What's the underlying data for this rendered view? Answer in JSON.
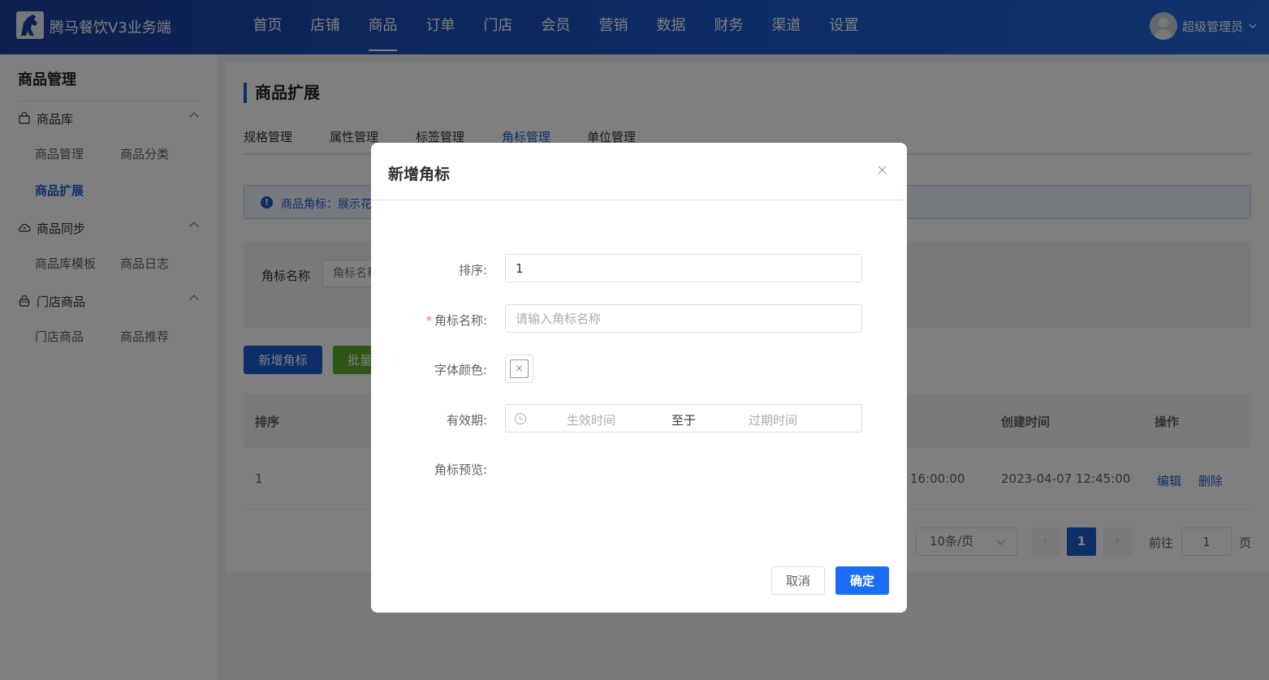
{
  "app": {
    "title": "腾马餐饮V3业务端"
  },
  "nav": {
    "items": [
      "首页",
      "店铺",
      "商品",
      "订单",
      "门店",
      "会员",
      "营销",
      "数据",
      "财务",
      "渠道",
      "设置"
    ],
    "active_index": 2
  },
  "user": {
    "name": "超级管理员"
  },
  "sidebar": {
    "title": "商品管理",
    "groups": [
      {
        "label": "商品库",
        "icon": "bag-icon",
        "items": [
          "商品管理",
          "商品分类",
          "商品扩展"
        ]
      },
      {
        "label": "商品同步",
        "icon": "cloud-sync-icon",
        "items": [
          "商品库模板",
          "商品日志"
        ]
      },
      {
        "label": "门店商品",
        "icon": "shop-bag-icon",
        "items": [
          "门店商品",
          "商品推荐"
        ]
      }
    ],
    "active_item": "商品扩展"
  },
  "page": {
    "title": "商品扩展",
    "tabs": [
      "规格管理",
      "属性管理",
      "标签管理",
      "角标管理",
      "单位管理"
    ],
    "active_tab": "角标管理",
    "tip": "商品角标：展示花"
  },
  "filter": {
    "label": "角标名称",
    "placeholder": "角标名称"
  },
  "actions": {
    "add_label": "新增角标",
    "batch_label": "批量"
  },
  "table": {
    "columns": [
      "排序",
      "创建时间",
      "操作"
    ],
    "rows": [
      {
        "sort": "1",
        "time_partial": "16:00:00",
        "created": "2023-04-07 12:45:00",
        "edit": "编辑",
        "delete": "删除"
      }
    ]
  },
  "pagination": {
    "page_size": "10条/页",
    "current": "1",
    "goto_label": "前往",
    "goto_value": "1",
    "page_unit": "页",
    "prev": "‹",
    "next": "›"
  },
  "dialog": {
    "title": "新增角标",
    "fields": {
      "sort_label": "排序:",
      "sort_value": "1",
      "name_required": "*",
      "name_label": "角标名称:",
      "name_placeholder": "请输入角标名称",
      "color_label": "字体颜色:",
      "color_empty_glyph": "×",
      "validity_label": "有效期:",
      "start_placeholder": "生效时间",
      "range_separator": "至于",
      "end_placeholder": "过期时间",
      "preview_label": "角标预览:"
    },
    "cancel": "取消",
    "confirm": "确定"
  },
  "colors": {
    "primary": "#1a5fd0",
    "confirm": "#1a6ef5",
    "batch": "#5aaa2e",
    "required": "#f56c6c",
    "topbar_start": "#1a3f9e",
    "topbar_end": "#2066d6"
  }
}
